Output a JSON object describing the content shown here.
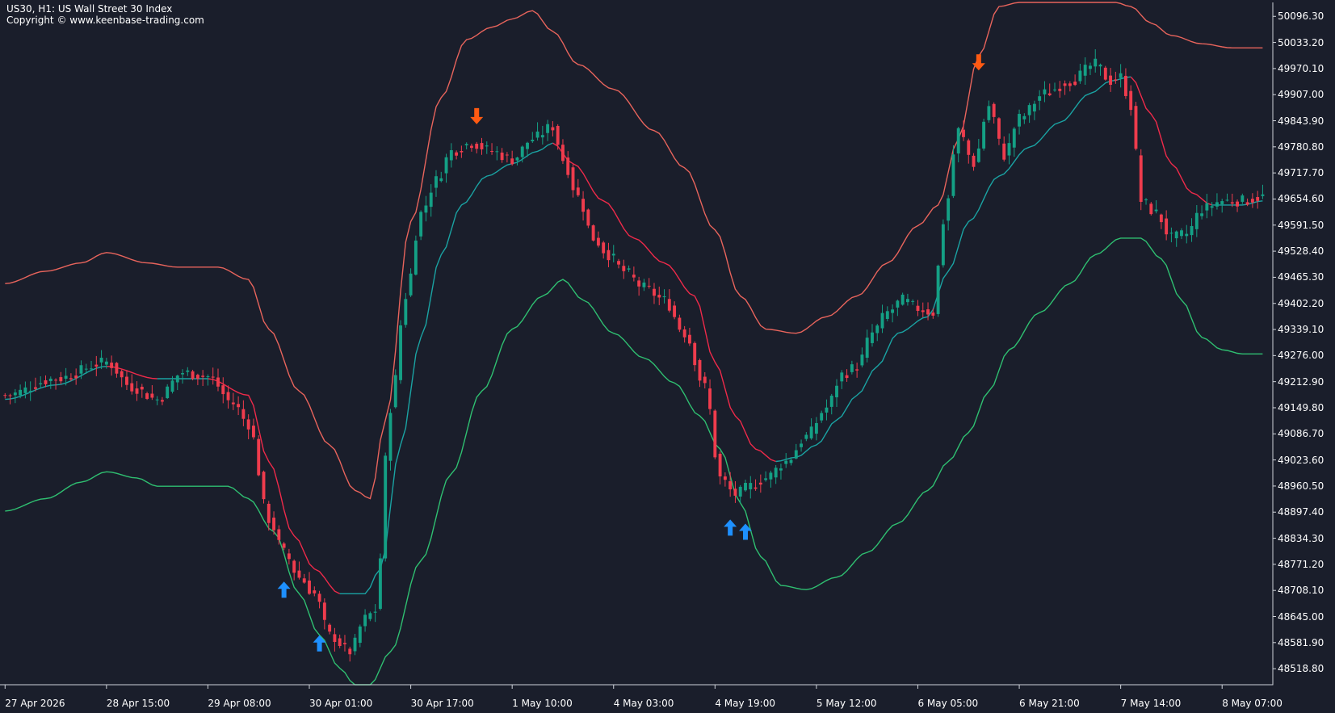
{
  "header": {
    "title": "US30, H1:  US Wall Street 30 Index",
    "copyright": "Copyright © www.keenbase-trading.com"
  },
  "colors": {
    "background": "#1a1e2b",
    "axis": "#cfd3da",
    "text": "#ffffff",
    "bull": "#14a085",
    "bear": "#ef3c4d",
    "upper_band": "#e8645c",
    "lower_band": "#2fbf71",
    "mid_falling": "#ef2a4a",
    "mid_rising": "#1aa3a3",
    "buy_arrow": "#1e90ff",
    "sell_arrow": "#ff5a12"
  },
  "chart_data": {
    "type": "candlestick",
    "symbol": "US30",
    "timeframe": "H1",
    "ylim": [
      48480,
      50130
    ],
    "xlim": [
      -1,
      250
    ],
    "y_ticks": [
      "50096.30",
      "50033.20",
      "49970.10",
      "49907.00",
      "49843.90",
      "49780.80",
      "49717.70",
      "49654.60",
      "49591.50",
      "49528.40",
      "49465.30",
      "49402.20",
      "49339.10",
      "49276.00",
      "49212.90",
      "49149.80",
      "49086.70",
      "49023.60",
      "48960.50",
      "48897.40",
      "48834.30",
      "48771.20",
      "48708.10",
      "48645.00",
      "48581.90",
      "48518.80"
    ],
    "x_ticks": [
      {
        "label": "27 Apr 2026",
        "bar": 0
      },
      {
        "label": "28 Apr 15:00",
        "bar": 20
      },
      {
        "label": "29 Apr 08:00",
        "bar": 40
      },
      {
        "label": "30 Apr 01:00",
        "bar": 60
      },
      {
        "label": "30 Apr 17:00",
        "bar": 80
      },
      {
        "label": "1 May 10:00",
        "bar": 100
      },
      {
        "label": "4 May 03:00",
        "bar": 120
      },
      {
        "label": "4 May 19:00",
        "bar": 140
      },
      {
        "label": "5 May 12:00",
        "bar": 160
      },
      {
        "label": "6 May 05:00",
        "bar": 180
      },
      {
        "label": "6 May 21:00",
        "bar": 200
      },
      {
        "label": "7 May 14:00",
        "bar": 220
      },
      {
        "label": "8 May 07:00",
        "bar": 240
      }
    ],
    "price_anchors": [
      [
        0,
        49180
      ],
      [
        10,
        49220
      ],
      [
        20,
        49260
      ],
      [
        25,
        49200
      ],
      [
        30,
        49170
      ],
      [
        35,
        49235
      ],
      [
        40,
        49225
      ],
      [
        45,
        49160
      ],
      [
        48,
        49110
      ],
      [
        52,
        48880
      ],
      [
        55,
        48800
      ],
      [
        58,
        48740
      ],
      [
        61,
        48700
      ],
      [
        64,
        48600
      ],
      [
        68,
        48560
      ],
      [
        71,
        48640
      ],
      [
        73,
        48660
      ],
      [
        76,
        49150
      ],
      [
        79,
        49420
      ],
      [
        82,
        49620
      ],
      [
        85,
        49700
      ],
      [
        88,
        49770
      ],
      [
        92,
        49790
      ],
      [
        96,
        49770
      ],
      [
        100,
        49750
      ],
      [
        104,
        49800
      ],
      [
        108,
        49830
      ],
      [
        110,
        49750
      ],
      [
        113,
        49660
      ],
      [
        116,
        49560
      ],
      [
        119,
        49520
      ],
      [
        122,
        49480
      ],
      [
        126,
        49440
      ],
      [
        130,
        49410
      ],
      [
        134,
        49330
      ],
      [
        138,
        49200
      ],
      [
        141,
        48980
      ],
      [
        144,
        48940
      ],
      [
        147,
        48960
      ],
      [
        150,
        48980
      ],
      [
        154,
        49020
      ],
      [
        158,
        49080
      ],
      [
        162,
        49150
      ],
      [
        165,
        49230
      ],
      [
        168,
        49250
      ],
      [
        171,
        49330
      ],
      [
        174,
        49380
      ],
      [
        177,
        49410
      ],
      [
        180,
        49390
      ],
      [
        183,
        49380
      ],
      [
        185,
        49600
      ],
      [
        188,
        49820
      ],
      [
        191,
        49740
      ],
      [
        194,
        49880
      ],
      [
        197,
        49760
      ],
      [
        200,
        49850
      ],
      [
        205,
        49910
      ],
      [
        210,
        49940
      ],
      [
        215,
        49980
      ],
      [
        218,
        49940
      ],
      [
        220,
        49950
      ],
      [
        222,
        49880
      ],
      [
        224,
        49650
      ],
      [
        227,
        49620
      ],
      [
        230,
        49560
      ],
      [
        233,
        49570
      ],
      [
        236,
        49630
      ],
      [
        240,
        49650
      ],
      [
        244,
        49650
      ],
      [
        248,
        49660
      ]
    ],
    "mid_anchors": [
      [
        0,
        49170
      ],
      [
        10,
        49205
      ],
      [
        20,
        49250
      ],
      [
        30,
        49220
      ],
      [
        40,
        49220
      ],
      [
        48,
        49180
      ],
      [
        52,
        49020
      ],
      [
        57,
        48840
      ],
      [
        61,
        48760
      ],
      [
        66,
        48700
      ],
      [
        71,
        48700
      ],
      [
        74,
        48760
      ],
      [
        78,
        49060
      ],
      [
        82,
        49320
      ],
      [
        86,
        49520
      ],
      [
        90,
        49640
      ],
      [
        95,
        49710
      ],
      [
        100,
        49740
      ],
      [
        105,
        49770
      ],
      [
        108,
        49790
      ],
      [
        112,
        49740
      ],
      [
        118,
        49650
      ],
      [
        124,
        49560
      ],
      [
        130,
        49500
      ],
      [
        136,
        49420
      ],
      [
        140,
        49260
      ],
      [
        144,
        49130
      ],
      [
        148,
        49050
      ],
      [
        152,
        49020
      ],
      [
        156,
        49030
      ],
      [
        160,
        49060
      ],
      [
        164,
        49120
      ],
      [
        168,
        49180
      ],
      [
        172,
        49250
      ],
      [
        176,
        49330
      ],
      [
        182,
        49370
      ],
      [
        186,
        49480
      ],
      [
        190,
        49600
      ],
      [
        196,
        49710
      ],
      [
        202,
        49780
      ],
      [
        208,
        49840
      ],
      [
        214,
        49910
      ],
      [
        218,
        49940
      ],
      [
        222,
        49950
      ],
      [
        226,
        49860
      ],
      [
        230,
        49740
      ],
      [
        234,
        49670
      ],
      [
        238,
        49640
      ],
      [
        244,
        49640
      ],
      [
        248,
        49650
      ]
    ],
    "upper_anchors": [
      [
        0,
        49450
      ],
      [
        8,
        49480
      ],
      [
        15,
        49500
      ],
      [
        20,
        49525
      ],
      [
        28,
        49500
      ],
      [
        34,
        49490
      ],
      [
        42,
        49490
      ],
      [
        48,
        49460
      ],
      [
        52,
        49340
      ],
      [
        58,
        49190
      ],
      [
        64,
        49060
      ],
      [
        69,
        48950
      ],
      [
        72,
        48930
      ],
      [
        75,
        49120
      ],
      [
        80,
        49600
      ],
      [
        86,
        49900
      ],
      [
        91,
        50040
      ],
      [
        96,
        50070
      ],
      [
        100,
        50090
      ],
      [
        104,
        50110
      ],
      [
        108,
        50060
      ],
      [
        113,
        49980
      ],
      [
        120,
        49920
      ],
      [
        128,
        49820
      ],
      [
        134,
        49730
      ],
      [
        140,
        49580
      ],
      [
        145,
        49420
      ],
      [
        150,
        49340
      ],
      [
        156,
        49330
      ],
      [
        162,
        49370
      ],
      [
        168,
        49420
      ],
      [
        174,
        49500
      ],
      [
        180,
        49590
      ],
      [
        184,
        49640
      ],
      [
        188,
        49800
      ],
      [
        192,
        50000
      ],
      [
        196,
        50120
      ],
      [
        200,
        50130
      ],
      [
        206,
        50130
      ],
      [
        213,
        50130
      ],
      [
        219,
        50130
      ],
      [
        222,
        50120
      ],
      [
        226,
        50080
      ],
      [
        230,
        50050
      ],
      [
        236,
        50030
      ],
      [
        242,
        50020
      ],
      [
        248,
        50020
      ]
    ],
    "lower_anchors": [
      [
        0,
        48900
      ],
      [
        8,
        48930
      ],
      [
        15,
        48970
      ],
      [
        20,
        48995
      ],
      [
        26,
        48980
      ],
      [
        30,
        48960
      ],
      [
        38,
        48960
      ],
      [
        44,
        48960
      ],
      [
        48,
        48930
      ],
      [
        53,
        48850
      ],
      [
        58,
        48700
      ],
      [
        62,
        48600
      ],
      [
        66,
        48520
      ],
      [
        69,
        48480
      ],
      [
        72,
        48480
      ],
      [
        76,
        48560
      ],
      [
        82,
        48780
      ],
      [
        88,
        48990
      ],
      [
        94,
        49190
      ],
      [
        100,
        49340
      ],
      [
        106,
        49420
      ],
      [
        110,
        49460
      ],
      [
        114,
        49410
      ],
      [
        120,
        49330
      ],
      [
        126,
        49270
      ],
      [
        132,
        49210
      ],
      [
        137,
        49130
      ],
      [
        141,
        49050
      ],
      [
        145,
        48920
      ],
      [
        149,
        48790
      ],
      [
        153,
        48720
      ],
      [
        158,
        48710
      ],
      [
        164,
        48740
      ],
      [
        170,
        48800
      ],
      [
        176,
        48870
      ],
      [
        182,
        48950
      ],
      [
        186,
        49020
      ],
      [
        190,
        49090
      ],
      [
        194,
        49190
      ],
      [
        198,
        49290
      ],
      [
        204,
        49380
      ],
      [
        210,
        49450
      ],
      [
        215,
        49520
      ],
      [
        220,
        49560
      ],
      [
        224,
        49560
      ],
      [
        228,
        49510
      ],
      [
        232,
        49410
      ],
      [
        236,
        49320
      ],
      [
        240,
        49290
      ],
      [
        244,
        49280
      ],
      [
        248,
        49280
      ]
    ],
    "buy_arrows": [
      [
        55,
        48710
      ],
      [
        62,
        48580
      ],
      [
        143,
        48860
      ],
      [
        146,
        48850
      ]
    ],
    "sell_arrows": [
      [
        93,
        49855
      ],
      [
        192,
        49985
      ]
    ]
  },
  "price_labels": [
    "50096.30",
    "50033.20",
    "49970.10",
    "49907.00",
    "49843.90",
    "49780.80",
    "49717.70",
    "49654.60",
    "49591.50",
    "49528.40",
    "49465.30",
    "49402.20",
    "49339.10",
    "49276.00",
    "49212.90",
    "49149.80",
    "49086.70",
    "49023.60",
    "48960.50",
    "48897.40",
    "48834.30",
    "48771.20",
    "48708.10",
    "48645.00",
    "48581.90",
    "48518.80"
  ],
  "time_labels": [
    "27 Apr 2026",
    "28 Apr 15:00",
    "29 Apr 08:00",
    "30 Apr 01:00",
    "30 Apr 17:00",
    "1 May 10:00",
    "4 May 03:00",
    "4 May 19:00",
    "5 May 12:00",
    "6 May 05:00",
    "6 May 21:00",
    "7 May 14:00",
    "8 May 07:00"
  ]
}
